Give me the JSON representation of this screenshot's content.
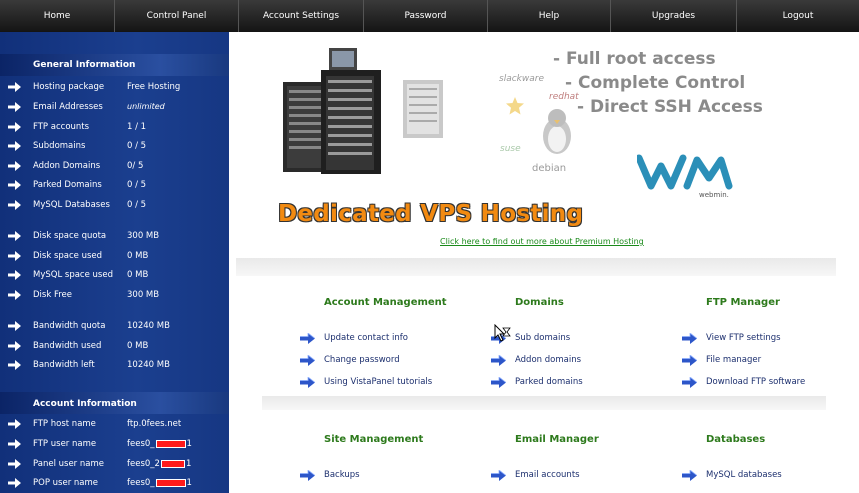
{
  "nav": {
    "items": [
      "Home",
      "Control Panel",
      "Account Settings",
      "Password",
      "Help",
      "Upgrades",
      "Logout"
    ]
  },
  "sidebar": {
    "general_heading": "General Information",
    "general_rows": [
      {
        "label": "Hosting package",
        "value": "Free Hosting"
      },
      {
        "label": "Email Addresses",
        "value": "unlimited"
      },
      {
        "label": "FTP accounts",
        "value": "1 / 1"
      },
      {
        "label": "Subdomains",
        "value": "0 / 5"
      },
      {
        "label": "Addon Domains",
        "value": "0/ 5"
      },
      {
        "label": "Parked Domains",
        "value": "0 / 5"
      },
      {
        "label": "MySQL Databases",
        "value": "0 / 5"
      },
      {
        "label": "Disk space quota",
        "value": "300 MB"
      },
      {
        "label": "Disk space used",
        "value": "0 MB"
      },
      {
        "label": "MySQL space used",
        "value": "0 MB"
      },
      {
        "label": "Disk Free",
        "value": "300 MB"
      },
      {
        "label": "Bandwidth quota",
        "value": "10240 MB"
      },
      {
        "label": "Bandwidth used",
        "value": "0 MB"
      },
      {
        "label": "Bandwidth left",
        "value": "10240 MB"
      }
    ],
    "account_heading": "Account Information",
    "account_rows": [
      {
        "label": "FTP host name",
        "value": "ftp.0fees.net"
      },
      {
        "label": "FTP user name",
        "prefix": "fees0_",
        "suffix": "1"
      },
      {
        "label": "Panel user name",
        "prefix": "fees0_2",
        "suffix": "1"
      },
      {
        "label": "POP user name",
        "prefix": "fees0_",
        "suffix": "1"
      }
    ]
  },
  "banner": {
    "promo_lines": [
      "- Full root access",
      "- Complete Control",
      "- Direct SSH Access"
    ],
    "logos": [
      "slackware",
      "redhat",
      "suse",
      "debian",
      "webmin."
    ],
    "title": "Dedicated VPS Hosting",
    "link": "Click here to find out more about Premium Hosting"
  },
  "sections": {
    "account_management": {
      "title": "Account Management",
      "links": [
        "Update contact info",
        "Change password",
        "Using VistaPanel tutorials"
      ]
    },
    "domains": {
      "title": "Domains",
      "links": [
        "Sub domains",
        "Addon domains",
        "Parked domains"
      ]
    },
    "ftp_manager": {
      "title": "FTP Manager",
      "links": [
        "View FTP settings",
        "File manager",
        "Download FTP software"
      ]
    },
    "site_management": {
      "title": "Site Management",
      "links": [
        "Backups"
      ]
    },
    "email_manager": {
      "title": "Email Manager",
      "links": [
        "Email accounts"
      ]
    },
    "databases": {
      "title": "Databases",
      "links": [
        "MySQL databases"
      ]
    }
  },
  "colors": {
    "nav_bg": "#1e1e1e",
    "sidebar_bg": "#1b3f8f",
    "section_title": "#2d7a1c",
    "link_text": "#1c2f6e",
    "vps_title": "#f28a11",
    "link_arrow": "#2d56c9"
  }
}
